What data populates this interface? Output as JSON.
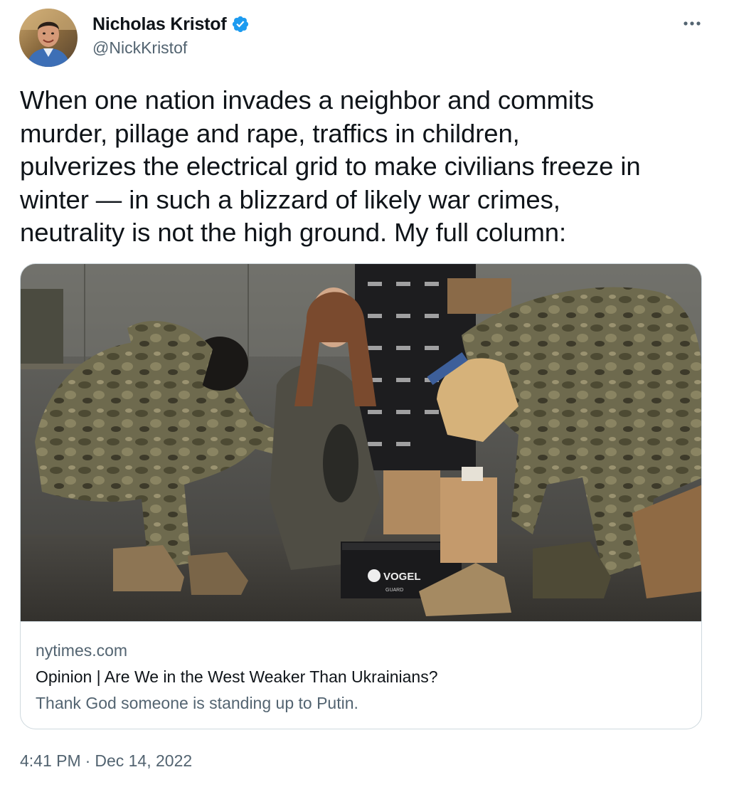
{
  "author": {
    "display_name": "Nicholas Kristof",
    "handle": "@NickKristof",
    "verified_icon": "verified-badge-icon",
    "avatar_icon": "profile-photo"
  },
  "more_icon": "more-options-icon",
  "tweet": {
    "text": "When one nation invades a neighbor and commits\nmurder, pillage and rape, traffics in children,\npulverizes the electrical grid to make civilians freeze in\nwinter — in such a blizzard of likely war crimes,\nneutrality is not the high ground. My full column:"
  },
  "card": {
    "image_text": "VOGEL",
    "image_subtext": "GUARD",
    "domain": "nytimes.com",
    "title": "Opinion | Are We in the West Weaker Than Ukrainians?",
    "description": "Thank God someone is standing up to Putin."
  },
  "timestamp": {
    "time": "4:41 PM",
    "separator": "·",
    "date": "Dec 14, 2022"
  },
  "colors": {
    "text_primary": "#0f1419",
    "text_secondary": "#536471",
    "verified_blue": "#1d9bf0",
    "border": "#cfd9de"
  }
}
